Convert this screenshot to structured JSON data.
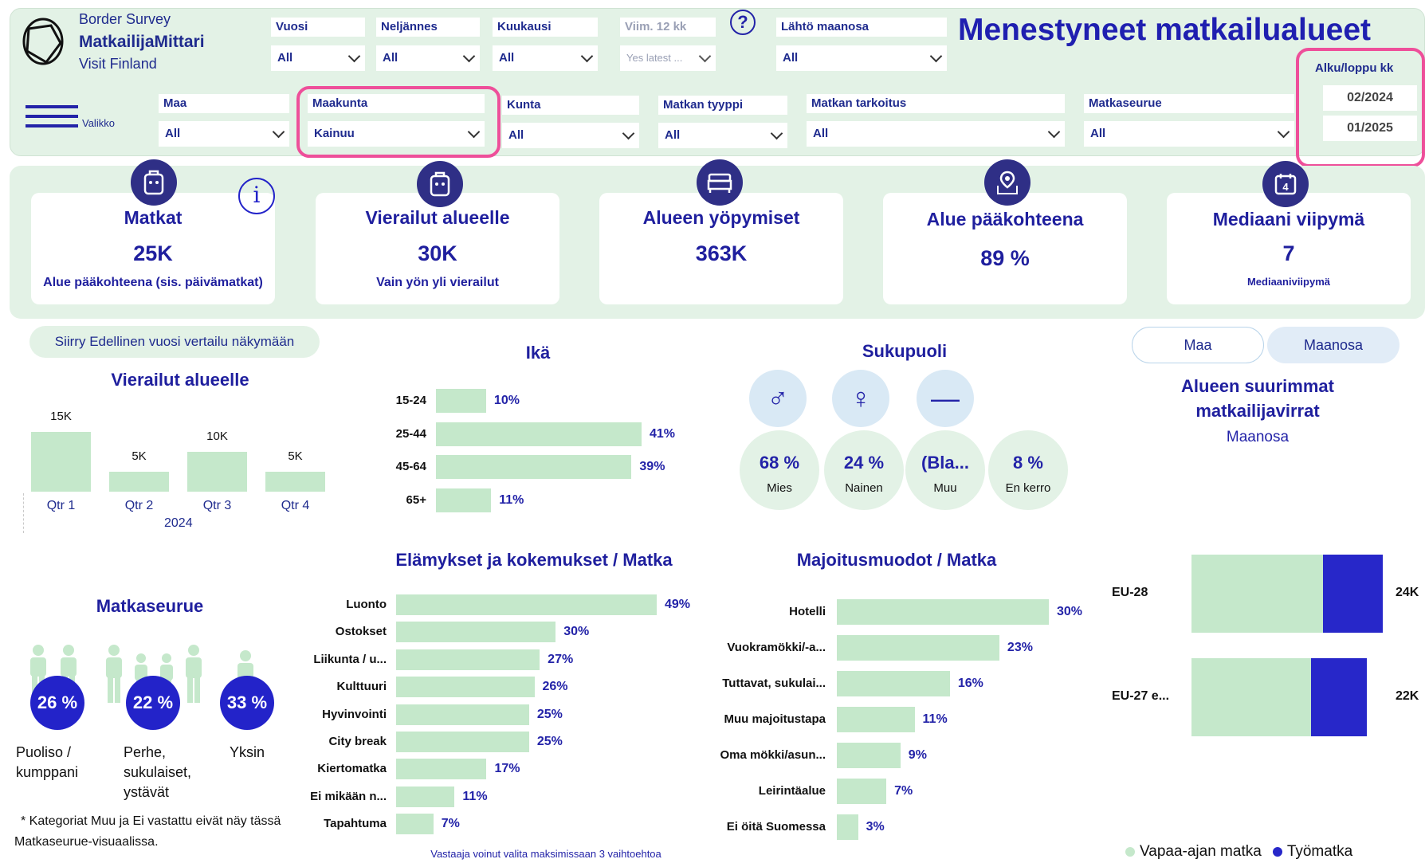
{
  "brand": {
    "line1": "Border Survey",
    "line2": "MatkailijaMittari",
    "line3": "Visit Finland"
  },
  "page_title": "Menestyneet matkailualueet",
  "menu_label": "Valikko",
  "filters_top": [
    {
      "label": "Vuosi",
      "value": "All"
    },
    {
      "label": "Neljännes",
      "value": "All"
    },
    {
      "label": "Kuukausi",
      "value": "All"
    },
    {
      "label": "Viim. 12 kk",
      "value": "Yes latest ..."
    },
    {
      "label": "Lähtö maanosa",
      "value": "All"
    }
  ],
  "filters_bottom": [
    {
      "label": "Maa",
      "value": "All"
    },
    {
      "label": "Maakunta",
      "value": "Kainuu"
    },
    {
      "label": "Kunta",
      "value": "All"
    },
    {
      "label": "Matkan tyyppi",
      "value": "All"
    },
    {
      "label": "Matkan tarkoitus",
      "value": "All"
    },
    {
      "label": "Matkaseurue",
      "value": "All"
    }
  ],
  "period": {
    "title": "Alku/loppu kk",
    "start": "02/2024",
    "end": "01/2025"
  },
  "kpis": [
    {
      "title": "Matkat",
      "value": "25K",
      "sub": "Alue pääkohteena (sis. päivämatkat)",
      "icon": "luggage-icon"
    },
    {
      "title": "Vierailut alueelle",
      "value": "30K",
      "sub": "Vain yön yli vierailut",
      "icon": "luggage-icon"
    },
    {
      "title": "Alueen yöpymiset",
      "value": "363K",
      "sub": "",
      "icon": "bed-icon"
    },
    {
      "title": "Alue pääkohteena",
      "value": "89 %",
      "sub": "",
      "icon": "map-pin-icon"
    },
    {
      "title": "Mediaani viipymä",
      "value": "7",
      "sub": "Mediaaniviipymä",
      "icon": "calendar-icon"
    }
  ],
  "compare_button": "Siirry Edellinen vuosi vertailu näkymään",
  "visits_chart": {
    "title": "Vierailut alueelle",
    "year_label": "2024",
    "chart_data": {
      "type": "bar",
      "categories": [
        "Qtr 1",
        "Qtr 2",
        "Qtr 3",
        "Qtr 4"
      ],
      "values": [
        15,
        5,
        10,
        5
      ],
      "labels": [
        "15K",
        "5K",
        "10K",
        "5K"
      ]
    }
  },
  "age_chart": {
    "title": "Ikä",
    "chart_data": {
      "type": "bar",
      "categories": [
        "15-24",
        "25-44",
        "45-64",
        "65+"
      ],
      "values": [
        10,
        41,
        39,
        11
      ],
      "labels": [
        "10%",
        "41%",
        "39%",
        "11%"
      ]
    }
  },
  "gender": {
    "title": "Sukupuoli",
    "items": [
      {
        "value": "68 %",
        "label": "Mies",
        "icon": "♂"
      },
      {
        "value": "24 %",
        "label": "Nainen",
        "icon": "♀"
      },
      {
        "value": "(Bla...",
        "label": "Muu",
        "icon": "—"
      },
      {
        "value": "8 %",
        "label": "En kerro",
        "icon": ""
      }
    ]
  },
  "flows": {
    "toggle_left": "Maa",
    "toggle_right": "Maanosa",
    "title_line1": "Alueen suurimmat",
    "title_line2": "matkailijavirrat",
    "subtitle": "Maanosa",
    "legend": [
      {
        "label": "Vapaa-ajan matka",
        "color": "#c5e8cb"
      },
      {
        "label": "Työmatka",
        "color": "#2727c9"
      }
    ],
    "chart_data": {
      "type": "bar",
      "categories": [
        "EU-28",
        "EU-27 e..."
      ],
      "series": [
        {
          "name": "Vapaa-ajan matka",
          "values": [
            16.5,
            15.0
          ]
        },
        {
          "name": "Työmatka",
          "values": [
            7.5,
            7.0
          ]
        }
      ],
      "totals": [
        "24K",
        "22K"
      ]
    }
  },
  "companions": {
    "title": "Matkaseurue",
    "items": [
      {
        "value": "26 %",
        "label_lines": [
          "Puoliso /",
          "kumppani"
        ]
      },
      {
        "value": "22 %",
        "label_lines": [
          "Perhe,",
          "sukulaiset,",
          "ystävät"
        ]
      },
      {
        "value": "33 %",
        "label_lines": [
          "Yksin"
        ]
      }
    ],
    "footnote_line1": "* Kategoriat Muu ja Ei vastattu eivät näy tässä",
    "footnote_line2": "Matkaseurue-visuaalissa."
  },
  "experiences": {
    "title": "Elämykset ja kokemukset / Matka",
    "note": "Vastaaja voinut valita maksimissaan 3 vaihtoehtoa",
    "chart_data": {
      "type": "bar",
      "categories": [
        "Luonto",
        "Ostokset",
        "Liikunta / u...",
        "Kulttuuri",
        "Hyvinvointi",
        "City break",
        "Kiertomatka",
        "Ei mikään n...",
        "Tapahtuma"
      ],
      "values": [
        49,
        30,
        27,
        26,
        25,
        25,
        17,
        11,
        7
      ],
      "labels": [
        "49%",
        "30%",
        "27%",
        "26%",
        "25%",
        "25%",
        "17%",
        "11%",
        "7%"
      ]
    }
  },
  "accommodation": {
    "title": "Majoitusmuodot / Matka",
    "chart_data": {
      "type": "bar",
      "categories": [
        "Hotelli",
        "Vuokramökki/-a...",
        "Tuttavat, sukulai...",
        "Muu majoitustapa",
        "Oma mökki/asun...",
        "Leirintäalue",
        "Ei öitä Suomessa"
      ],
      "values": [
        30,
        23,
        16,
        11,
        9,
        7,
        3
      ],
      "labels": [
        "30%",
        "23%",
        "16%",
        "11%",
        "9%",
        "7%",
        "3%"
      ]
    }
  }
}
